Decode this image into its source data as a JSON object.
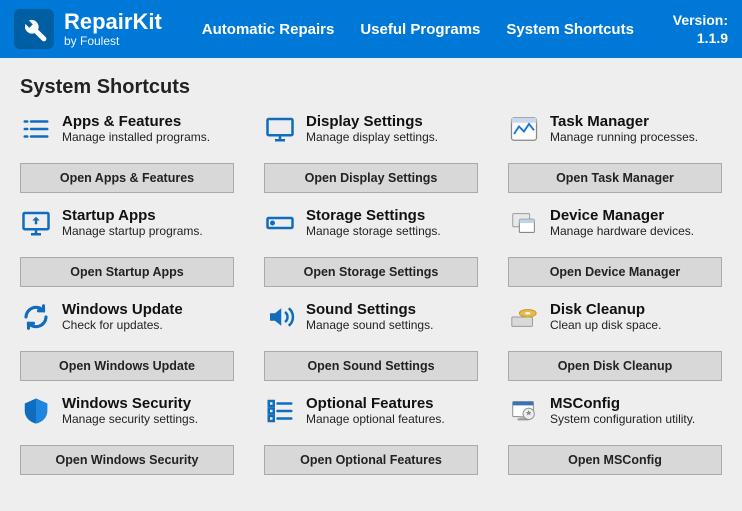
{
  "app": {
    "name": "RepairKit",
    "subtitle": "by Foulest",
    "version_label": "Version:",
    "version": "1.1.9"
  },
  "nav": {
    "auto": "Automatic Repairs",
    "programs": "Useful Programs",
    "shortcuts": "System Shortcuts"
  },
  "page_title": "System Shortcuts",
  "cards": {
    "apps": {
      "title": "Apps & Features",
      "desc": "Manage installed programs.",
      "btn": "Open Apps & Features"
    },
    "display": {
      "title": "Display Settings",
      "desc": "Manage display settings.",
      "btn": "Open Display Settings"
    },
    "task": {
      "title": "Task Manager",
      "desc": "Manage running processes.",
      "btn": "Open Task Manager"
    },
    "startup": {
      "title": "Startup Apps",
      "desc": "Manage startup programs.",
      "btn": "Open Startup Apps"
    },
    "storage": {
      "title": "Storage Settings",
      "desc": "Manage storage settings.",
      "btn": "Open Storage Settings"
    },
    "device": {
      "title": "Device Manager",
      "desc": "Manage hardware devices.",
      "btn": "Open Device Manager"
    },
    "update": {
      "title": "Windows Update",
      "desc": "Check for updates.",
      "btn": "Open Windows Update"
    },
    "sound": {
      "title": "Sound Settings",
      "desc": "Manage sound settings.",
      "btn": "Open Sound Settings"
    },
    "disk": {
      "title": "Disk Cleanup",
      "desc": "Clean up disk space.",
      "btn": "Open Disk Cleanup"
    },
    "security": {
      "title": "Windows Security",
      "desc": "Manage security settings.",
      "btn": "Open Windows Security"
    },
    "optional": {
      "title": "Optional Features",
      "desc": "Manage optional features.",
      "btn": "Open Optional Features"
    },
    "msconfig": {
      "title": "MSConfig",
      "desc": "System configuration utility.",
      "btn": "Open MSConfig"
    }
  }
}
